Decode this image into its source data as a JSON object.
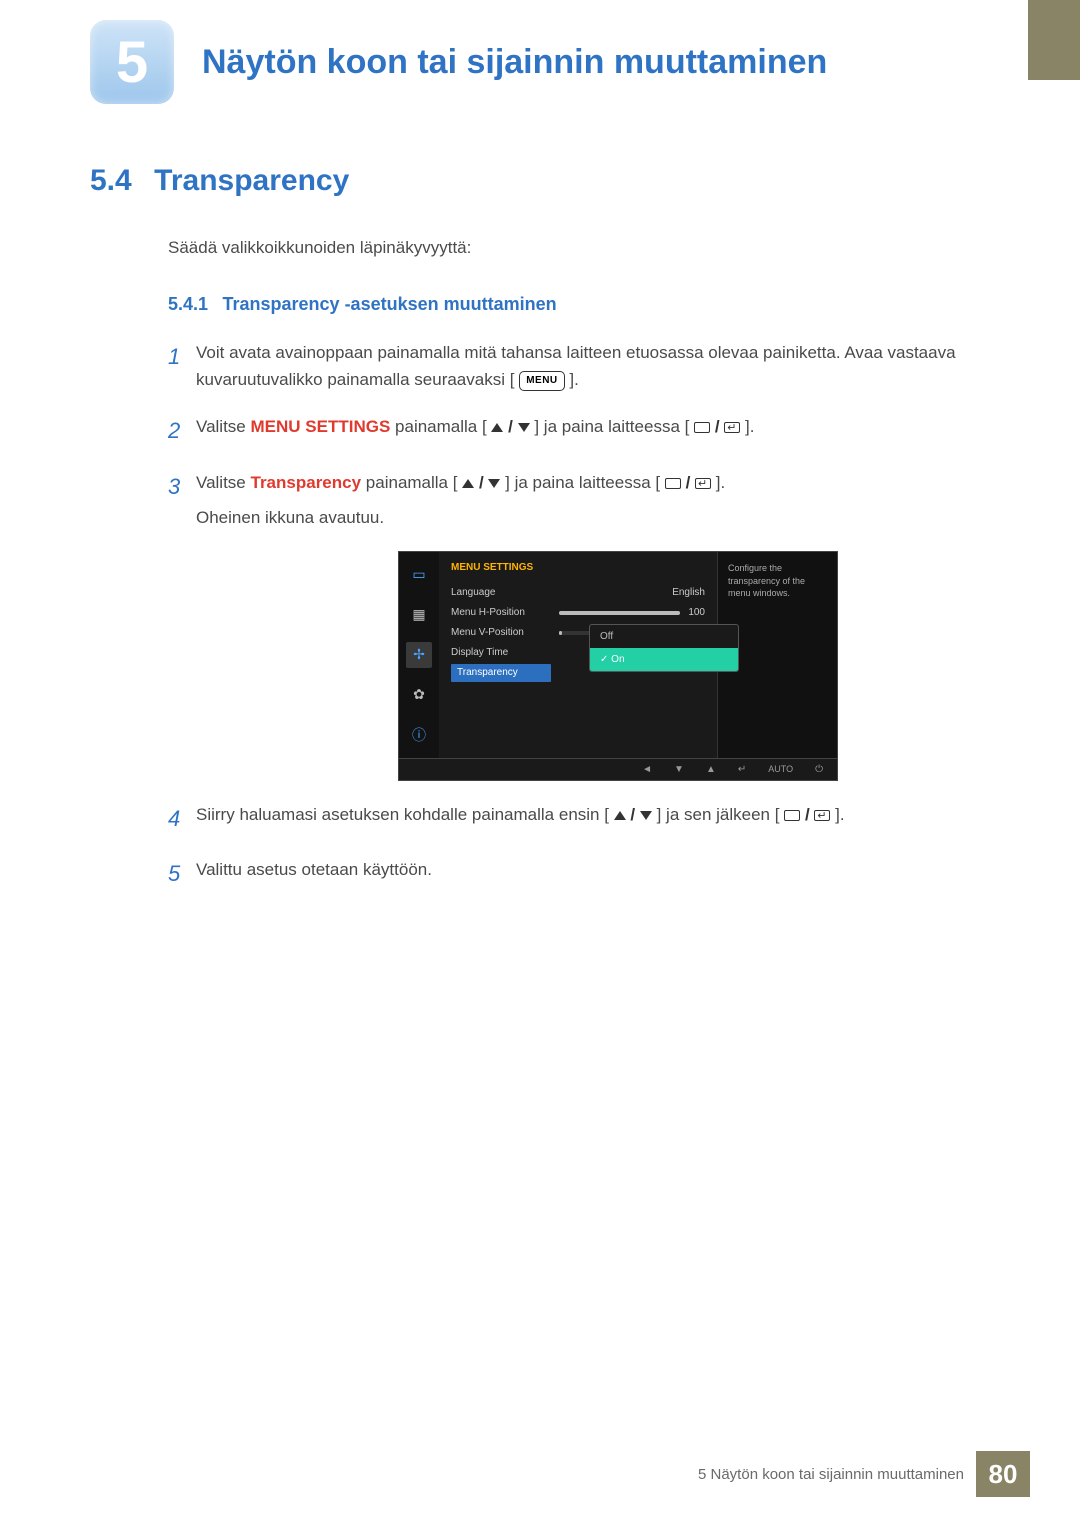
{
  "chapter": {
    "number": "5",
    "title": "Näytön koon tai sijainnin muuttaminen"
  },
  "section": {
    "number": "5.4",
    "title": "Transparency"
  },
  "intro": "Säädä valikkoikkunoiden läpinäkyvyyttä:",
  "subsection": {
    "number": "5.4.1",
    "title": "Transparency -asetuksen muuttaminen"
  },
  "steps": {
    "s1n": "1",
    "s1a": "Voit avata avainoppaan painamalla mitä tahansa laitteen etuosassa olevaa painiketta. Avaa vastaava kuvaruutuvalikko painamalla seuraavaksi [",
    "s1m": "MENU",
    "s1b": "].",
    "s2n": "2",
    "s2a": "Valitse ",
    "s2menu": "MENU SETTINGS",
    "s2b": " painamalla [",
    "s2c": "] ja paina laitteessa [",
    "s2d": "].",
    "s3n": "3",
    "s3a": "Valitse ",
    "s3menu": "Transparency",
    "s3b": " painamalla [",
    "s3c": "] ja paina laitteessa [",
    "s3d": "].",
    "s3e": "Oheinen ikkuna avautuu.",
    "s4n": "4",
    "s4a": "Siirry haluamasi asetuksen kohdalle painamalla ensin [",
    "s4b": "] ja sen jälkeen [",
    "s4c": "].",
    "s5n": "5",
    "s5a": "Valittu asetus otetaan käyttöön."
  },
  "osd": {
    "title": "MENU SETTINGS",
    "rows": {
      "language": {
        "label": "Language",
        "value": "English"
      },
      "hpos": {
        "label": "Menu H-Position",
        "value": "100",
        "fill_pct": 100
      },
      "vpos": {
        "label": "Menu V-Position",
        "value": "1",
        "fill_pct": 2
      },
      "dtime": {
        "label": "Display Time"
      },
      "trans": {
        "label": "Transparency"
      }
    },
    "popup": {
      "off": "Off",
      "on": "On"
    },
    "help": "Configure the transparency of the menu windows.",
    "footer": {
      "auto": "AUTO"
    }
  },
  "footer": {
    "text": "5 Näytön koon tai sijainnin muuttaminen",
    "page": "80"
  }
}
